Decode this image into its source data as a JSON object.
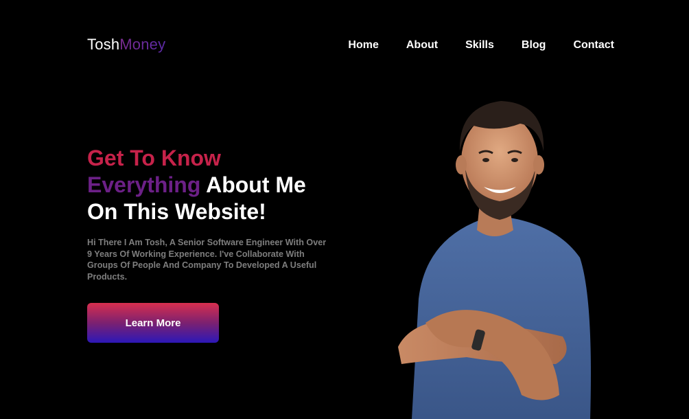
{
  "brand": {
    "part1": "Tosh",
    "part2": "Money"
  },
  "nav": {
    "items": [
      "Home",
      "About",
      "Skills",
      "Blog",
      "Contact"
    ]
  },
  "hero": {
    "title_red": "Get To Know",
    "title_purple": "Everything",
    "title_white_1": " About Me",
    "title_white_2": "On This Website!",
    "description": "Hi There I Am Tosh, A Senior Software Engineer With Over 9 Years Of Working Experience. I've Collaborate With Groups Of People And Company To Developed A Useful Products.",
    "cta_label": "Learn More"
  },
  "colors": {
    "background": "#000000",
    "accent_red": "#c6224a",
    "accent_purple": "#6c2087",
    "button_gradient_top": "#d82f4e",
    "button_gradient_bottom": "#2c18b8",
    "body_text": "#7e7e7e"
  },
  "portrait": {
    "icon": "person-portrait-photo"
  }
}
